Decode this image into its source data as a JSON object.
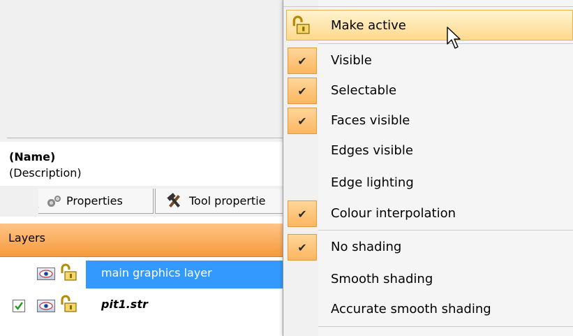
{
  "panel": {
    "name": "(Name)",
    "description": "(Description)",
    "tabs": [
      {
        "label": "Properties",
        "icon": "gears-icon"
      },
      {
        "label": "Tool propertie",
        "icon": "hammer-wrench-icon"
      }
    ]
  },
  "layers": {
    "title": "Layers",
    "items": [
      {
        "label": "main graphics layer",
        "checked": false,
        "visible": true,
        "locked": true,
        "selected": true
      },
      {
        "label": "pit1.str",
        "checked": true,
        "visible": true,
        "locked": true,
        "selected": false
      }
    ]
  },
  "menu": {
    "items": [
      {
        "label": "Make active",
        "icon": "lock-icon",
        "checked": false,
        "highlighted": true
      },
      {
        "label": "Visible",
        "checked": true
      },
      {
        "label": "Selectable",
        "checked": true
      },
      {
        "label": "Faces visible",
        "checked": true
      },
      {
        "label": "Edges visible",
        "checked": false
      },
      {
        "label": "Edge lighting",
        "checked": false
      },
      {
        "label": "Colour interpolation",
        "checked": true
      },
      {
        "label": "No shading",
        "checked": true
      },
      {
        "label": "Smooth shading",
        "checked": false
      },
      {
        "label": "Accurate smooth shading",
        "checked": false
      }
    ],
    "check_glyph": "✔"
  },
  "colors": {
    "layers_header": "#f59b3c",
    "selection": "#3399ff",
    "menu_highlight": "#ffd98c",
    "menu_check": "#fbb660"
  }
}
